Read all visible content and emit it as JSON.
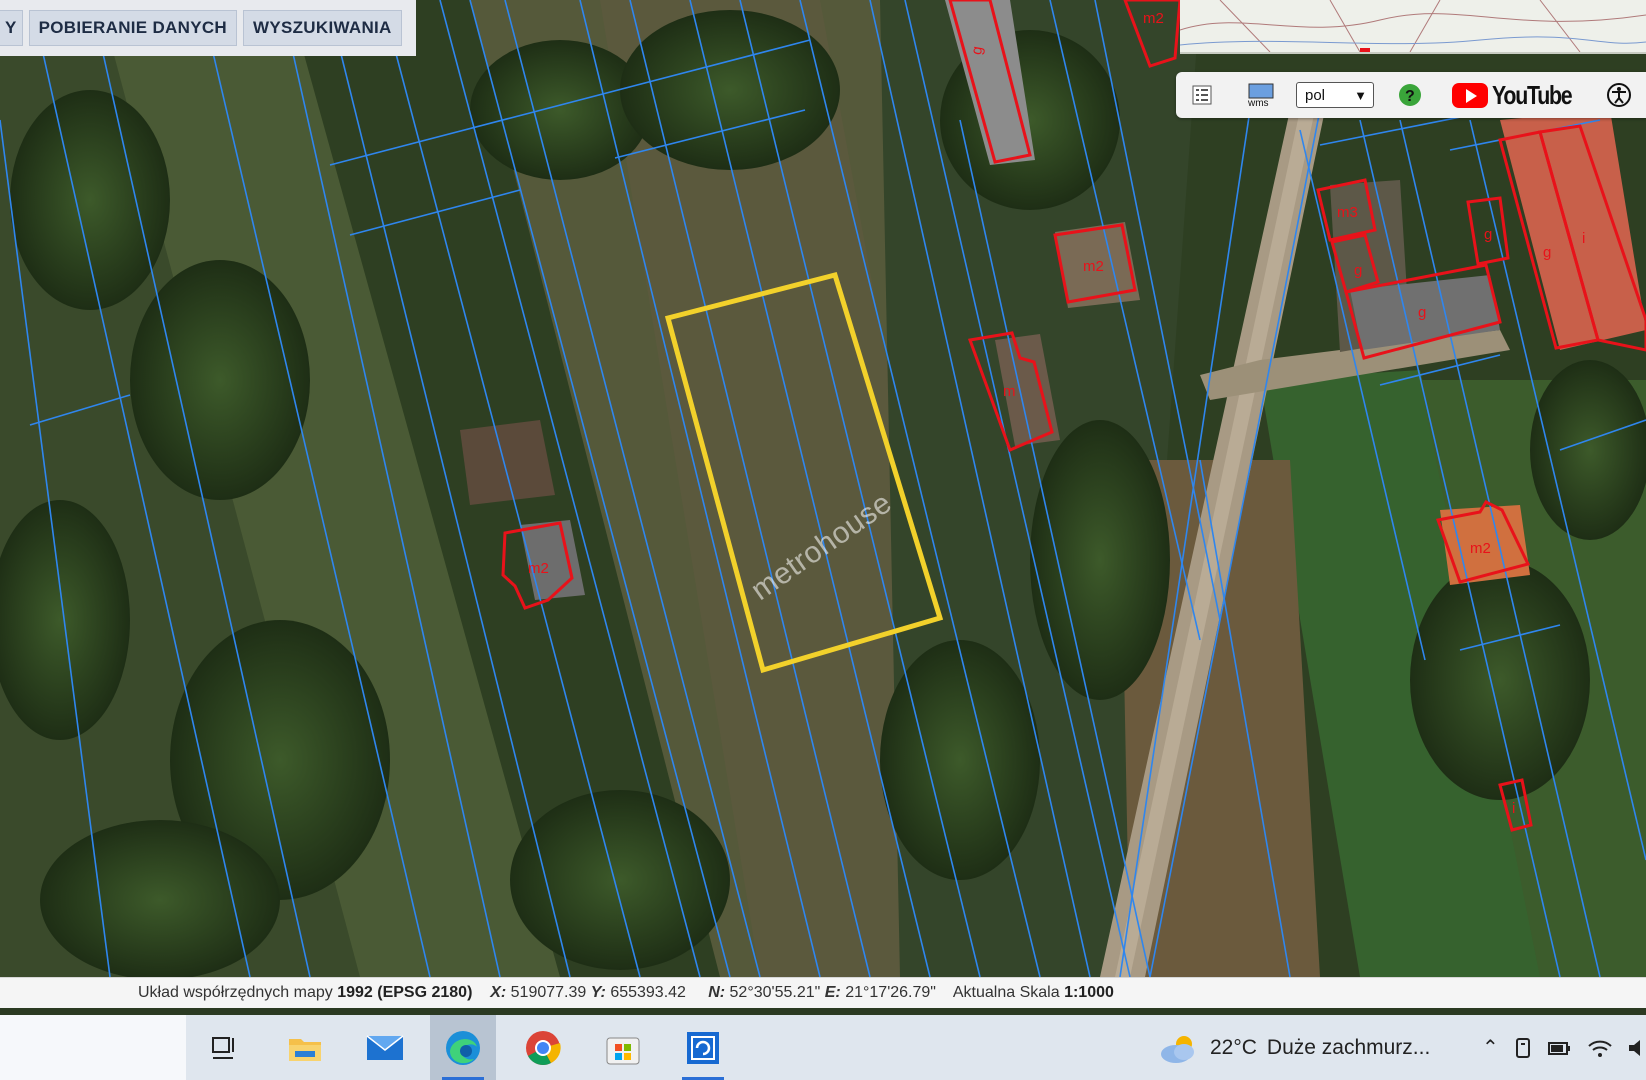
{
  "top_buttons": {
    "cut_label": "Y",
    "download_label": "POBIERANIE DANYCH",
    "search_label": "WYSZUKIWANIA"
  },
  "toolbar": {
    "language_value": "pol",
    "youtube_label": "YouTube"
  },
  "map": {
    "watermark": "metrohouse",
    "building_labels": [
      "g",
      "m2",
      "m2",
      "m",
      "m2",
      "m3",
      "g",
      "g",
      "g",
      "g",
      "i",
      "m2",
      "i"
    ],
    "parcel_highlight_color": "#f2d12b",
    "building_outline_color": "#e8121a",
    "parcel_line_color": "#2f7fe6"
  },
  "status": {
    "crs_label": "Układ współrzędnych mapy",
    "crs_value": "1992 (EPSG 2180)",
    "x_label": "X:",
    "x_value": "519077.39",
    "y_label": "Y:",
    "y_value": "655393.42",
    "n_label": "N:",
    "n_value": "52°30'55.21\"",
    "e_label": "E:",
    "e_value": "21°17'26.79\"",
    "scale_label": "Aktualna Skala",
    "scale_value": "1:1000"
  },
  "taskbar": {
    "weather_temp": "22°C",
    "weather_desc": "Duże zachmurz..."
  }
}
